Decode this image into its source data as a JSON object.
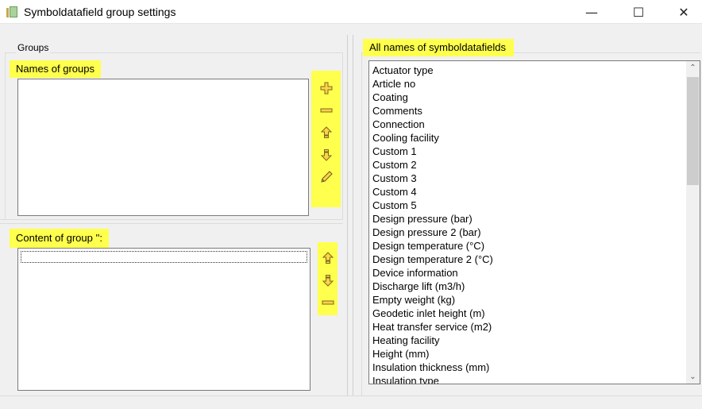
{
  "window": {
    "title": "Symboldatafield group settings",
    "minimize": "—",
    "maximize": "☐",
    "close": "✕"
  },
  "groups": {
    "box_label": "Groups",
    "names_label": "Names of groups",
    "content_label": "Content of group '':"
  },
  "all_fields": {
    "label": "All names of symboldatafields",
    "items": [
      "Actuator type",
      "Article no",
      "Coating",
      "Comments",
      "Connection",
      "Cooling facility",
      "Custom 1",
      "Custom 2",
      "Custom 3",
      "Custom 4",
      "Custom 5",
      "Design pressure (bar)",
      "Design pressure 2 (bar)",
      "Design temperature (°C)",
      "Design temperature 2 (°C)",
      "Device information",
      "Discharge lift (m3/h)",
      "Empty weight (kg)",
      "Geodetic inlet height (m)",
      "Heat transfer service (m2)",
      "Heating facility",
      "Height (mm)",
      "Insulation thickness (mm)",
      "Insulation type"
    ]
  },
  "scrollbar": {
    "up_arrow": "⌃",
    "down_arrow": "⌄"
  },
  "icons": {
    "add": "plus-icon",
    "remove": "minus-icon",
    "up": "arrow-up-icon",
    "down": "arrow-down-icon",
    "rename": "pencil-icon"
  },
  "colors": {
    "highlight": "#ffff4d",
    "icon_fill": "#ffd24a",
    "icon_stroke": "#7a6a1a"
  }
}
